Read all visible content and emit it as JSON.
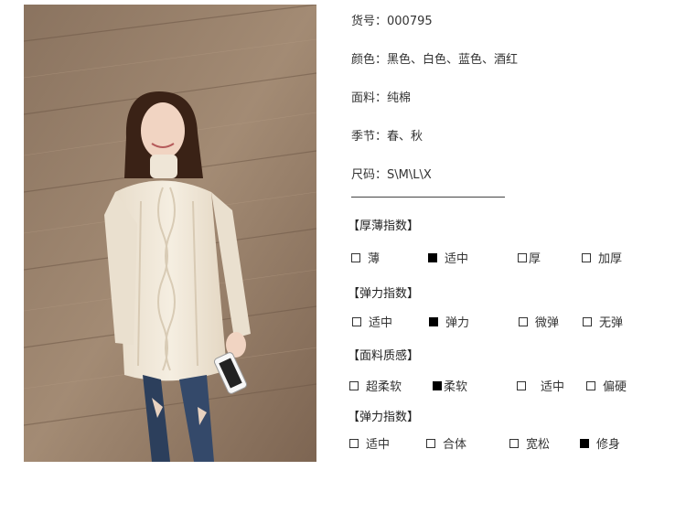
{
  "specs": {
    "item_no_label": "货号：",
    "item_no": "000795",
    "color_label": "颜色：",
    "colors": "黑色、白色、蓝色、酒红",
    "fabric_label": "面料：",
    "fabric": "纯棉",
    "season_label": "季节：",
    "season": "春、秋",
    "size_label": "尺码：",
    "sizes": "S\\M\\L\\X"
  },
  "sections": [
    {
      "title": "【厚薄指数】",
      "options": [
        {
          "label": "薄",
          "checked": false
        },
        {
          "label": "适中",
          "checked": true
        },
        {
          "label": "厚",
          "checked": false
        },
        {
          "label": "加厚",
          "checked": false
        }
      ]
    },
    {
      "title": "【弹力指数】",
      "options": [
        {
          "label": "适中",
          "checked": false
        },
        {
          "label": "弹力",
          "checked": true
        },
        {
          "label": "微弹",
          "checked": false
        },
        {
          "label": "无弹",
          "checked": false
        }
      ]
    },
    {
      "title": "【面料质感】",
      "options": [
        {
          "label": "超柔软",
          "checked": false
        },
        {
          "label": "柔软",
          "checked": true
        },
        {
          "label": "适中",
          "checked": false
        },
        {
          "label": "偏硬",
          "checked": false
        }
      ]
    },
    {
      "title": "【弹力指数】",
      "options": [
        {
          "label": "适中",
          "checked": false
        },
        {
          "label": "合体",
          "checked": false
        },
        {
          "label": "宽松",
          "checked": false
        },
        {
          "label": "修身",
          "checked": true
        }
      ]
    }
  ]
}
